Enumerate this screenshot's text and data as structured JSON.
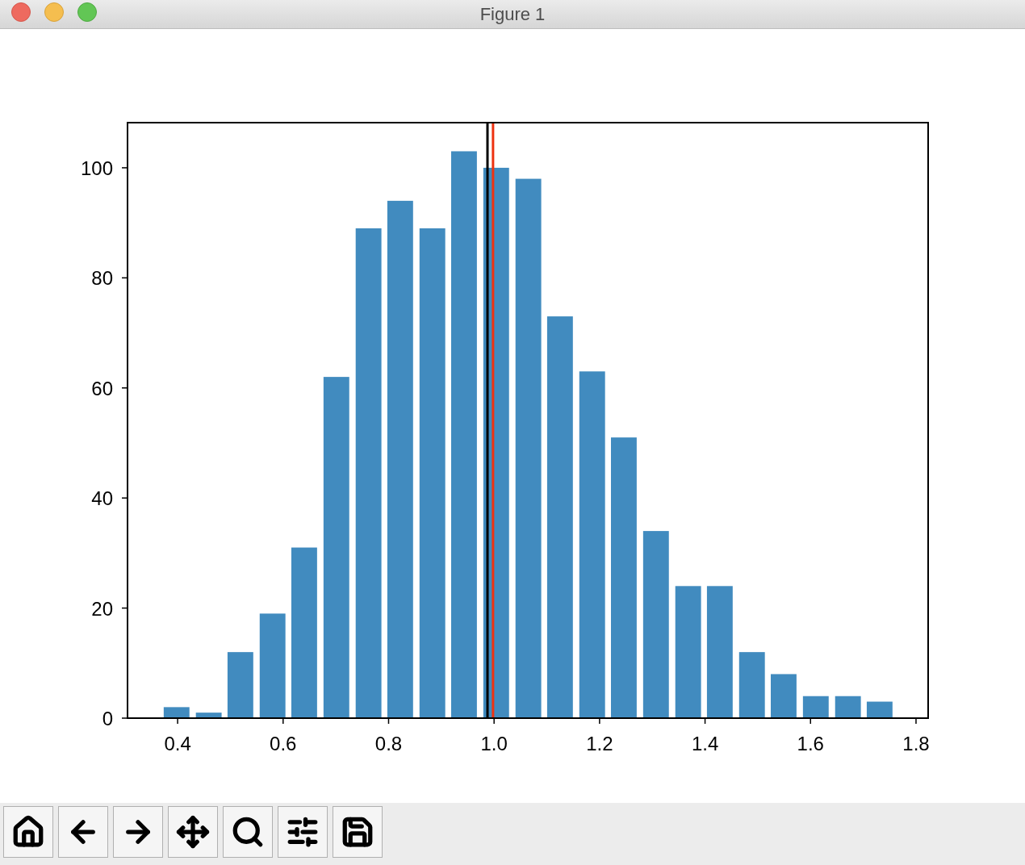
{
  "window": {
    "title": "Figure 1"
  },
  "figure": {
    "chart_data": {
      "type": "bar",
      "x": [
        0.398,
        0.459,
        0.519,
        0.58,
        0.64,
        0.701,
        0.762,
        0.822,
        0.883,
        0.943,
        1.004,
        1.065,
        1.125,
        1.186,
        1.246,
        1.307,
        1.368,
        1.428,
        1.489,
        1.549,
        1.61,
        1.671,
        1.731
      ],
      "series": [
        {
          "color": "#418bbf",
          "values": [
            2,
            1,
            12,
            19,
            31,
            62,
            89,
            94,
            89,
            103,
            100,
            98,
            73,
            63,
            51,
            34,
            24,
            24,
            12,
            8,
            4,
            4,
            3
          ]
        }
      ],
      "xlim": [
        0.305,
        1.823
      ],
      "ylim": [
        0,
        108.2
      ],
      "xticks": [
        {
          "value": 0.4,
          "label": "0.4"
        },
        {
          "value": 0.6,
          "label": "0.6"
        },
        {
          "value": 0.8,
          "label": "0.8"
        },
        {
          "value": 1.0,
          "label": "1.0"
        },
        {
          "value": 1.2,
          "label": "1.2"
        },
        {
          "value": 1.4,
          "label": "1.4"
        },
        {
          "value": 1.6,
          "label": "1.6"
        },
        {
          "value": 1.8,
          "label": "1.8"
        }
      ],
      "yticks": [
        {
          "value": 0,
          "label": "0"
        },
        {
          "value": 20,
          "label": "20"
        },
        {
          "value": 40,
          "label": "40"
        },
        {
          "value": 60,
          "label": "60"
        },
        {
          "value": 80,
          "label": "80"
        },
        {
          "value": 100,
          "label": "100"
        }
      ],
      "ref_lines": [
        {
          "axis": "x",
          "value": 0.9875,
          "color": "#000000"
        },
        {
          "axis": "x",
          "value": 0.998,
          "color": "#ee3311"
        }
      ]
    }
  }
}
